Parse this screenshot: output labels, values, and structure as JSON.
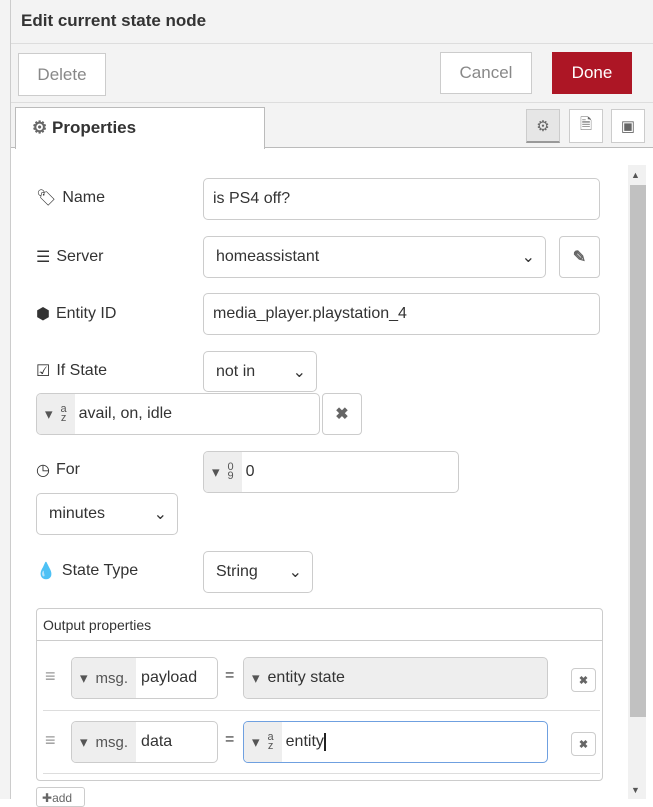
{
  "dialog": {
    "title": "Edit current state node",
    "delete": "Delete",
    "cancel": "Cancel",
    "done": "Done",
    "tab": "Properties",
    "done_color": "#ad1625"
  },
  "form": {
    "name_label": "Name",
    "name_value": "is PS4 off?",
    "server_label": "Server",
    "server_value": "homeassistant",
    "entity_label": "Entity ID",
    "entity_value": "media_player.playstation_4",
    "ifstate_label": "If State",
    "ifstate_op": "not in",
    "ifstate_value": "avail, on, idle",
    "for_label": "For",
    "for_value": "0",
    "for_units": "minutes",
    "statetype_label": "State Type",
    "statetype_value": "String",
    "output_label": "Output properties",
    "outputs": [
      {
        "prefix": "msg.",
        "property": "payload",
        "eq": "=",
        "value": "entity state"
      },
      {
        "prefix": "msg.",
        "property": "data",
        "eq": "=",
        "value": "entity"
      }
    ],
    "add": "add"
  }
}
